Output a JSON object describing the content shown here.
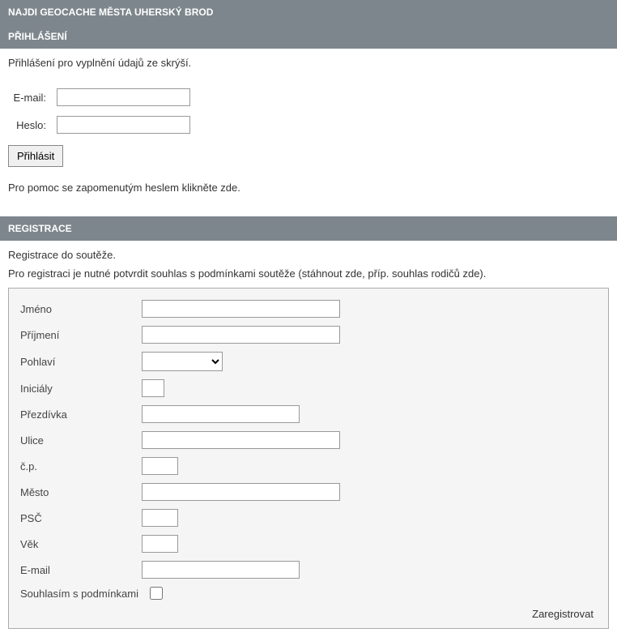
{
  "header": {
    "title": "NAJDI GEOCACHE MĚSTA UHERSKÝ BROD"
  },
  "login": {
    "heading": "PŘIHLÁŠENÍ",
    "intro": "Přihlášení pro vyplnění údajů ze skrýší.",
    "email_label": "E-mail:",
    "password_label": "Heslo:",
    "button_label": "Přihlásit",
    "help_text": "Pro pomoc se zapomenutým heslem klikněte zde."
  },
  "registration": {
    "heading": "REGISTRACE",
    "intro1": "Registrace do soutěže.",
    "intro2": "Pro registraci je nutné potvrdit souhlas s podmínkami soutěže (stáhnout zde, příp. souhlas rodičů zde).",
    "fields": {
      "firstname": "Jméno",
      "lastname": "Příjmení",
      "gender": "Pohlaví",
      "initials": "Iniciály",
      "nickname": "Přezdívka",
      "street": "Ulice",
      "houseno": "č.p.",
      "city": "Město",
      "zip": "PSČ",
      "age": "Věk",
      "email": "E-mail"
    },
    "consent_label": "Souhlasím s podmínkami",
    "submit_label": "Zaregistrovat"
  }
}
